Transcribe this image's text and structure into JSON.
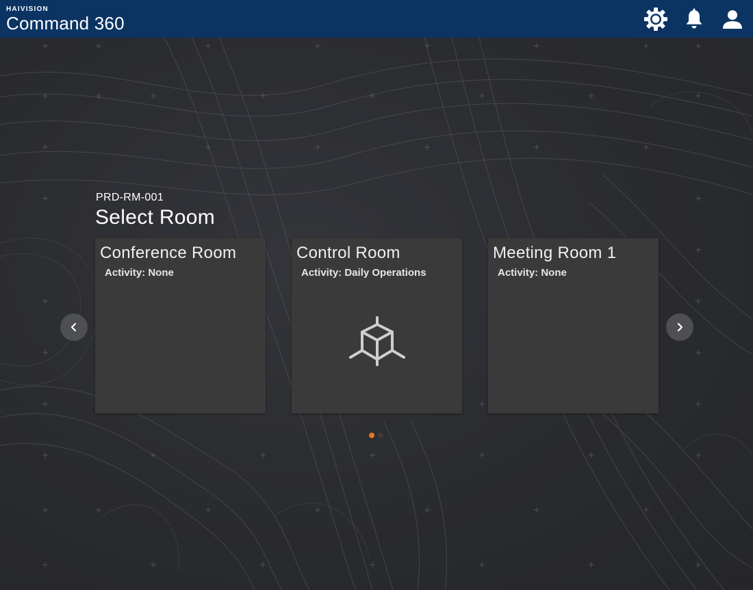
{
  "header": {
    "brand_small": "HAIVISION",
    "brand_large": "Command 360",
    "icons": [
      "settings-gear-icon",
      "notification-bell-icon",
      "user-account-icon"
    ]
  },
  "room": {
    "id": "PRD-RM-001",
    "title": "Select Room"
  },
  "cards": [
    {
      "title": "Conference Room",
      "activity": "Activity: None",
      "icon": null
    },
    {
      "title": "Control Room",
      "activity": "Activity: Daily Operations",
      "icon": "cube-icon"
    },
    {
      "title": "Meeting Room 1",
      "activity": "Activity: None",
      "icon": null
    }
  ],
  "carousel": {
    "prev_icon": "chevron-left-icon",
    "next_icon": "chevron-right-icon",
    "page_count": 2,
    "active_page": 1
  },
  "colors": {
    "header_bg": "#0b3463",
    "card_bg": "#3a3a3a",
    "dot_active": "#e87722",
    "dot_inactive": "#3b3b3b"
  }
}
